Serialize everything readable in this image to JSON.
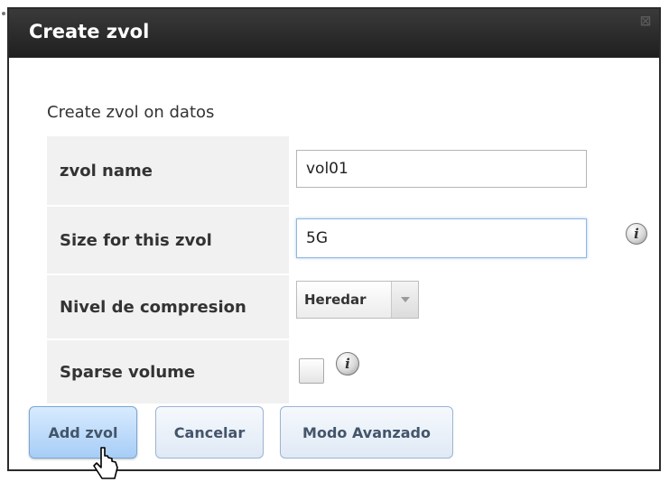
{
  "dialog": {
    "title": "Create zvol",
    "close_glyph": "⊠",
    "subtitle": "Create zvol on datos"
  },
  "form": {
    "zvol_name": {
      "label": "zvol name",
      "value": "vol01"
    },
    "size": {
      "label": "Size for this zvol",
      "value": "5G",
      "info_glyph": "i"
    },
    "compression": {
      "label": "Nivel de compresion",
      "selected": "Heredar"
    },
    "sparse": {
      "label": "Sparse volume",
      "checked": false,
      "info_glyph": "i"
    }
  },
  "buttons": {
    "add_label": "Add zvol",
    "cancel_label": "Cancelar",
    "advanced_label": "Modo Avanzado"
  },
  "icons": {
    "close": "close-icon",
    "info": "info-icon",
    "dropdown": "chevron-down-icon",
    "pointer": "mouse-pointer-icon"
  },
  "colors": {
    "titlebar": "#2b2b2b",
    "label_cell_bg": "#f1f1f1",
    "primary_button": "#a7cdf6",
    "input_focus_border": "#8fb6e0"
  }
}
